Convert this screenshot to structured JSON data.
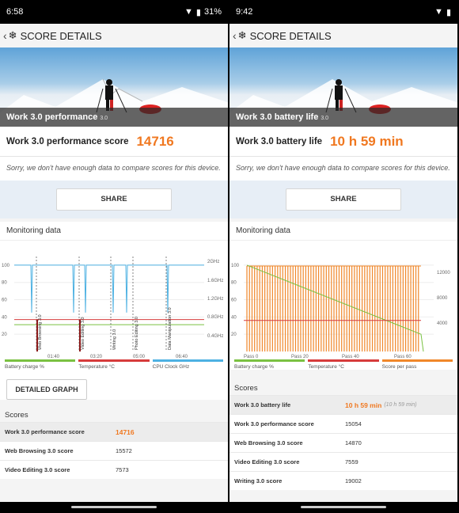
{
  "left": {
    "status": {
      "time": "6:58",
      "battery": "31%"
    },
    "appbar": {
      "title": "SCORE DETAILS"
    },
    "hero": {
      "title": "Work 3.0 performance",
      "version": "3.0"
    },
    "score": {
      "label": "Work 3.0 performance score",
      "value": "14716"
    },
    "note": "Sorry, we don't have enough data to compare scores for this device.",
    "share_label": "SHARE",
    "monitoring_title": "Monitoring data",
    "chart_data": {
      "type": "line",
      "y_left_ticks": [
        "100",
        "80",
        "60",
        "40",
        "20"
      ],
      "y_right_ticks": [
        "2GHz",
        "1.6GHz",
        "1.2GHz",
        "0.8GHz",
        "0.4GHz"
      ],
      "x_ticks": [
        "01:40",
        "03:20",
        "05:00",
        "06:40"
      ],
      "markers": [
        "Web Browsing 3.0",
        "Video Editing 3.0",
        "Writing 3.0",
        "Photo Editing 3.0",
        "Data Manipulation 3.0"
      ],
      "series": [
        {
          "name": "Battery charge %",
          "color": "#7ac142",
          "values": [
            31,
            31,
            31,
            31,
            31,
            31,
            31,
            31,
            31
          ]
        },
        {
          "name": "Temperature °C",
          "color": "#d63b3b",
          "values": [
            37,
            37,
            37,
            37,
            37,
            37,
            37,
            37,
            37
          ]
        },
        {
          "name": "CPU Clock GHz",
          "color": "#4db1e2"
        }
      ]
    },
    "legend": [
      "Battery charge %",
      "Temperature °C",
      "CPU Clock GHz"
    ],
    "detailed_graph_label": "DETAILED GRAPH",
    "scores_title": "Scores",
    "scores": [
      {
        "name": "Work 3.0 performance score",
        "value": "14716"
      },
      {
        "name": "Web Browsing 3.0 score",
        "value": "15572"
      },
      {
        "name": "Video Editing 3.0 score",
        "value": "7573"
      }
    ]
  },
  "right": {
    "status": {
      "time": "9:42"
    },
    "appbar": {
      "title": "SCORE DETAILS"
    },
    "hero": {
      "title": "Work 3.0 battery life",
      "version": "3.0"
    },
    "score": {
      "label": "Work 3.0 battery life",
      "value": "10 h 59 min"
    },
    "note": "Sorry, we don't have enough data to compare scores for this device.",
    "share_label": "SHARE",
    "monitoring_title": "Monitoring data",
    "chart_data": {
      "type": "line",
      "y_left_ticks": [
        "100",
        "80",
        "60",
        "40",
        "20"
      ],
      "y_right_ticks": [
        "12000",
        "8000",
        "4000"
      ],
      "x_ticks": [
        "Pass 0",
        "Pass 20",
        "Pass 40",
        "Pass 60"
      ],
      "series": [
        {
          "name": "Battery charge %",
          "color": "#7ac142",
          "x": [
            0,
            68
          ],
          "values": [
            100,
            20
          ]
        },
        {
          "name": "Temperature °C",
          "color": "#d63b3b",
          "values": [
            36,
            36
          ]
        },
        {
          "name": "Score per pass",
          "color": "#f0872a"
        }
      ]
    },
    "legend": [
      "Battery charge %",
      "Temperature °C",
      "Score per pass"
    ],
    "scores_title": "Scores",
    "scores": [
      {
        "name": "Work 3.0 battery life",
        "value": "10 h 59 min",
        "sub": "(10 h 59 min)"
      },
      {
        "name": "Work 3.0 performance score",
        "value": "15054"
      },
      {
        "name": "Web Browsing 3.0 score",
        "value": "14870"
      },
      {
        "name": "Video Editing 3.0 score",
        "value": "7559"
      },
      {
        "name": "Writing 3.0 score",
        "value": "19002"
      }
    ]
  },
  "colors": {
    "accent": "#f07820",
    "battery": "#7ac142",
    "temperature": "#d63b3b",
    "cpu": "#4db1e2",
    "score_pass": "#f0872a"
  }
}
